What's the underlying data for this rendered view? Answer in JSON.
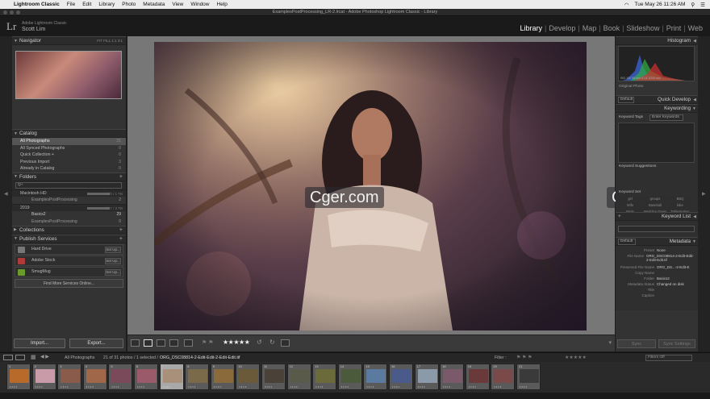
{
  "menubar": {
    "app": "Lightroom Classic",
    "items": [
      "File",
      "Edit",
      "Library",
      "Photo",
      "Metadata",
      "View",
      "Window",
      "Help"
    ],
    "clock": "Tue May 26  11:26 AM"
  },
  "window_title": "ExamplesPostProcessing_LR-2.lrcat - Adobe Photoshop Lightroom Classic - Library",
  "identity": {
    "logo": "Lr",
    "sub": "Adobe Lightroom Classic",
    "name": "Scott Lim"
  },
  "modules": [
    "Library",
    "Develop",
    "Map",
    "Book",
    "Slideshow",
    "Print",
    "Web"
  ],
  "left": {
    "navigator": {
      "title": "Navigator",
      "opts": "FIT  FILL  1:1  3:1"
    },
    "catalog": {
      "title": "Catalog",
      "rows": [
        {
          "label": "All Photographs",
          "count": "31"
        },
        {
          "label": "All Synced Photographs",
          "count": "0"
        },
        {
          "label": "Quick Collection +",
          "count": "0"
        },
        {
          "label": "Previous Import",
          "count": "3"
        },
        {
          "label": "Already in Catalog",
          "count": "0"
        }
      ]
    },
    "folders": {
      "title": "Folders",
      "search": "Q+",
      "vol1": {
        "name": "Macintosh HD",
        "n": "4/0 / 1 TB"
      },
      "f1": {
        "name": "ExamplesPostProcessing",
        "count": "2"
      },
      "vol2": {
        "name": "2019",
        "n": "1 / 7 / 2 TB"
      },
      "f2": {
        "name": "Basics2",
        "count": "29"
      },
      "f3": {
        "name": "ExamplesPostProcessing",
        "count": "0"
      }
    },
    "collections": "Collections",
    "publish": {
      "title": "Publish Services",
      "services": [
        {
          "name": "Hard Drive",
          "btn": "Set Up..."
        },
        {
          "name": "Adobe Stock",
          "btn": "Set Up..."
        },
        {
          "name": "SmugMug",
          "btn": "Set Up..."
        }
      ],
      "find": "Find More Services Online..."
    },
    "import": "Import...",
    "export": "Export..."
  },
  "toolbar": {
    "stars": "★★★★★"
  },
  "right": {
    "histogram": {
      "title": "Histogram",
      "info": "ISO 100    55 mm    f/1.8    1/200 sec",
      "original": "Original Photo"
    },
    "quick_develop": {
      "title": "Quick Develop",
      "preset": "Default"
    },
    "keywording": {
      "title": "Keywording",
      "tags_label": "Keyword Tags",
      "tags_value": "Enter Keywords",
      "suggestions": "Keyword Suggestions",
      "set_label": "Keyword Set",
      "set_items": [
        "girl",
        "groups",
        "BBQ",
        "Wife",
        "Baseball",
        "bike",
        "Bride",
        "Wedding Dress",
        "TableSetting"
      ]
    },
    "keyword_list": {
      "title": "Keyword List"
    },
    "metadata": {
      "title": "Metadata",
      "preset_dd": "Default",
      "rows": [
        {
          "k": "Preset",
          "v": "None"
        },
        {
          "k": "File Name",
          "v": "ORG_DSC08814-2-Edit-Edit-2-Edit-Edit.tif"
        },
        {
          "k": "Preserved File Name",
          "v": "ORG_DS...-2-Edit-E"
        },
        {
          "k": "Copy Name",
          "v": ""
        },
        {
          "k": "Folder",
          "v": "Basics2"
        },
        {
          "k": "Metadata Status",
          "v": "Changed on disk"
        },
        {
          "k": "Title",
          "v": ""
        },
        {
          "k": "Caption",
          "v": ""
        }
      ]
    },
    "sync": "Sync",
    "sync_settings": "Sync Settings"
  },
  "filmbar": {
    "source": "All Photographs",
    "info": "21 of 31 photos / 1 selected /",
    "file": "ORG_DSC08814-2-Edit-Edit-2-Edit-Edit.tif",
    "filter": "Filter :",
    "filter_dd": "Filters Off"
  },
  "film": {
    "numbers": [
      "1",
      "2",
      "3",
      "4",
      "5",
      "6",
      "7",
      "8",
      "9",
      "10",
      "11",
      "12",
      "13",
      "14",
      "15",
      "16",
      "17",
      "18",
      "19",
      "20",
      "21"
    ]
  },
  "watermark": "Cger.com",
  "colors": {
    "accent": "#ffffff",
    "panel": "#333333",
    "bg": "#1e1e1e"
  }
}
